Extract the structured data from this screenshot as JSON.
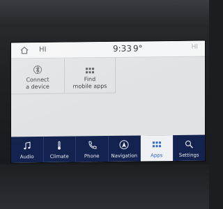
{
  "status": {
    "greeting": "HI",
    "time": "9:33",
    "temperature": "9°",
    "right_text": "HI"
  },
  "apps": [
    {
      "label": "Connect\na device",
      "icon": "bluetooth-icon"
    },
    {
      "label": "Find\nmobile apps",
      "icon": "grid-icon"
    }
  ],
  "nav": [
    {
      "label": "Audio",
      "icon": "music-note-icon"
    },
    {
      "label": "Climate",
      "icon": "thermometer-icon"
    },
    {
      "label": "Phone",
      "icon": "phone-icon"
    },
    {
      "label": "Navigation",
      "icon": "navigation-icon"
    },
    {
      "label": "Apps",
      "icon": "apps-grid-icon",
      "active": true
    },
    {
      "label": "Settings",
      "icon": "settings-icon"
    }
  ],
  "colors": {
    "nav_bg": "#0e1e4a",
    "active_accent": "#2e62c8",
    "screen_bg": "#e3e5e7"
  }
}
